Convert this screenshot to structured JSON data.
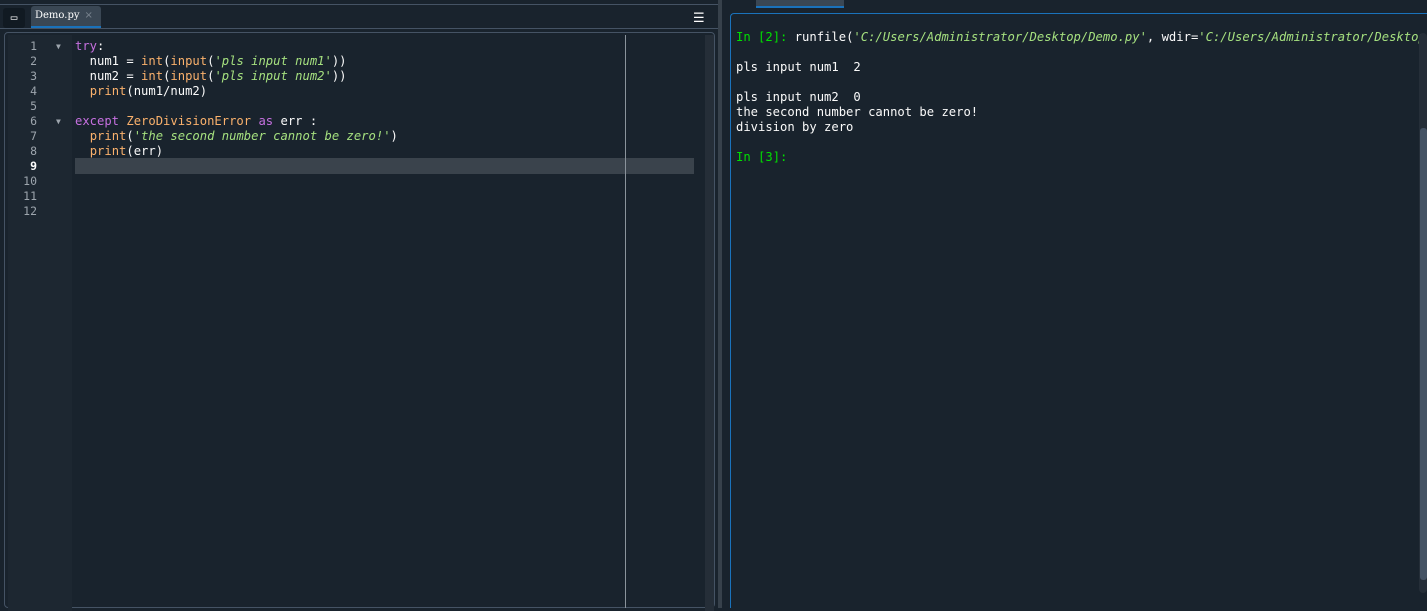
{
  "editor": {
    "tab_label": "Demo.py",
    "tab_close": "×",
    "menu_icon": "☰",
    "current_line": 9,
    "line_numbers": [
      "1",
      "2",
      "3",
      "4",
      "5",
      "6",
      "7",
      "8",
      "9",
      "10",
      "11",
      "12"
    ],
    "lines": [
      [
        {
          "t": "try",
          "c": "kw"
        },
        {
          "t": ":",
          "c": ""
        }
      ],
      [
        {
          "t": "  num1 = ",
          "c": ""
        },
        {
          "t": "int",
          "c": "bi"
        },
        {
          "t": "(",
          "c": ""
        },
        {
          "t": "input",
          "c": "bi"
        },
        {
          "t": "(",
          "c": ""
        },
        {
          "t": "'pls input num1'",
          "c": "str"
        },
        {
          "t": "))",
          "c": ""
        }
      ],
      [
        {
          "t": "  num2 = ",
          "c": ""
        },
        {
          "t": "int",
          "c": "bi"
        },
        {
          "t": "(",
          "c": ""
        },
        {
          "t": "input",
          "c": "bi"
        },
        {
          "t": "(",
          "c": ""
        },
        {
          "t": "'pls input num2'",
          "c": "str"
        },
        {
          "t": "))",
          "c": ""
        }
      ],
      [
        {
          "t": "  ",
          "c": ""
        },
        {
          "t": "print",
          "c": "bi"
        },
        {
          "t": "(num1/num2)",
          "c": ""
        }
      ],
      [],
      [
        {
          "t": "except ",
          "c": "kw"
        },
        {
          "t": "ZeroDivisionError",
          "c": "cls"
        },
        {
          "t": " ",
          "c": ""
        },
        {
          "t": "as",
          "c": "kw"
        },
        {
          "t": " err :",
          "c": ""
        }
      ],
      [
        {
          "t": "  ",
          "c": ""
        },
        {
          "t": "print",
          "c": "bi"
        },
        {
          "t": "(",
          "c": ""
        },
        {
          "t": "'the second number cannot be zero!'",
          "c": "str"
        },
        {
          "t": ")",
          "c": ""
        }
      ],
      [
        {
          "t": "  ",
          "c": ""
        },
        {
          "t": "print",
          "c": "bi"
        },
        {
          "t": "(err)",
          "c": ""
        }
      ],
      [],
      [],
      [],
      []
    ],
    "fold_lines": [
      1,
      6
    ]
  },
  "console": {
    "lines": [
      [
        {
          "t": "In [",
          "c": "prompt"
        },
        {
          "t": "2",
          "c": "prompt"
        },
        {
          "t": "]: ",
          "c": "prompt"
        },
        {
          "t": "runfile(",
          "c": ""
        },
        {
          "t": "'C:/Users/Administrator/Desktop/Demo.py'",
          "c": "str"
        },
        {
          "t": ", wdir=",
          "c": ""
        },
        {
          "t": "'C:/Users/Administrator/Desktop'",
          "c": "str"
        },
        {
          "t": ")",
          "c": ""
        }
      ],
      [],
      [
        {
          "t": "pls input num1  2",
          "c": ""
        }
      ],
      [],
      [
        {
          "t": "pls input num2  0",
          "c": ""
        }
      ],
      [
        {
          "t": "the second number cannot be zero!",
          "c": ""
        }
      ],
      [
        {
          "t": "division by zero",
          "c": ""
        }
      ],
      [],
      [
        {
          "t": "In [",
          "c": "prompt"
        },
        {
          "t": "3",
          "c": "prompt"
        },
        {
          "t": "]:",
          "c": "prompt"
        }
      ]
    ]
  }
}
